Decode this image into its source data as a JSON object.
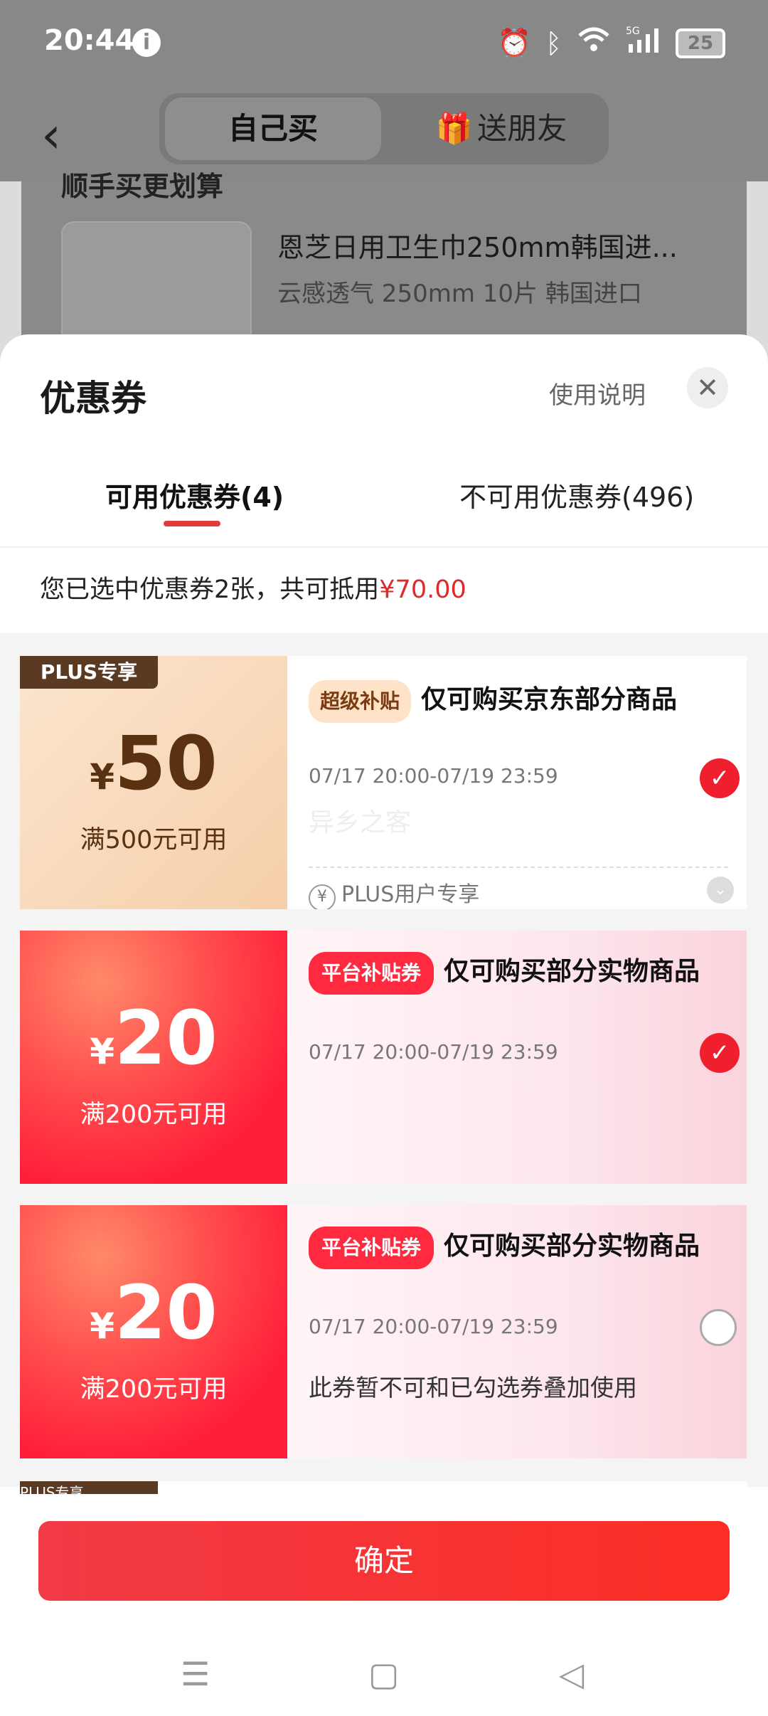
{
  "status": {
    "time": "20:44",
    "network": "5G",
    "battery": "25"
  },
  "header": {
    "tab_self": "自己买",
    "tab_friend": "送朋友"
  },
  "background": {
    "section_title": "顺手买更划算",
    "product_name": "恩芝日用卫生巾250mm韩国进...",
    "product_spec": "云感透气 250mm 10片 韩国进口"
  },
  "sheet": {
    "title": "优惠券",
    "usage_link": "使用说明",
    "tabs": {
      "available": "可用优惠券(4)",
      "unavailable": "不可用优惠券(496)"
    },
    "summary_prefix": "您已选中优惠券2张，共可抵用",
    "summary_amount": "¥70.00"
  },
  "coupons": [
    {
      "tag_left": "PLUS专享",
      "yen": "¥",
      "amount": "50",
      "condition": "满500元可用",
      "badge": "超级补贴",
      "title": "仅可购买京东部分商品",
      "date": "07/17 20:00-07/19 23:59",
      "watermark": "异乡之客",
      "footer": "PLUS用户专享",
      "checked": true
    },
    {
      "yen": "¥",
      "amount": "20",
      "condition": "满200元可用",
      "badge": "平台补贴券",
      "title": "仅可购买部分实物商品",
      "date": "07/17 20:00-07/19 23:59",
      "checked": true
    },
    {
      "yen": "¥",
      "amount": "20",
      "condition": "满200元可用",
      "badge": "平台补贴券",
      "title": "仅可购买部分实物商品",
      "date": "07/17 20:00-07/19 23:59",
      "note": "此券暂不可和已勾选券叠加使用",
      "checked": false
    }
  ],
  "peek_tag": "PLUS专享",
  "confirm": "确定",
  "colors": {
    "accent": "#ef1f2d",
    "amount": "#e02a2a"
  }
}
